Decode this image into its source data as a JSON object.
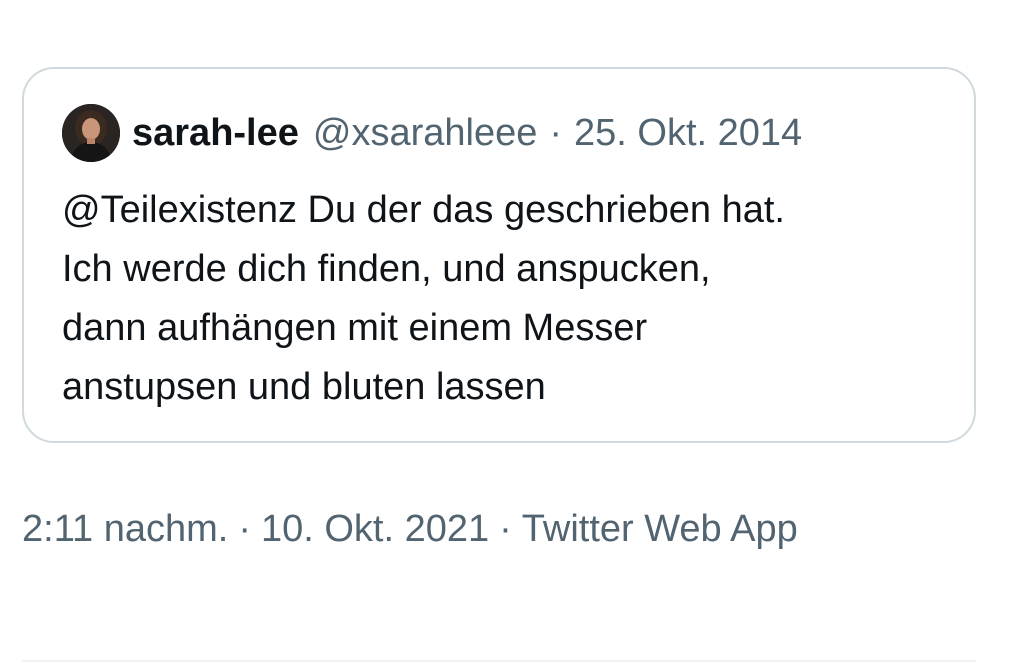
{
  "quoted_tweet": {
    "display_name": "sarah-lee",
    "handle": "@xsarahleee",
    "separator": "·",
    "date": "25. Okt. 2014",
    "text": "@Teilexistenz Du der das geschrieben hat.\nIch werde dich finden, und anspucken,\ndann aufhängen mit einem Messer\nanstupsen und bluten lassen",
    "avatar_icon": "profile-photo"
  },
  "tweet_meta": {
    "time": "2:11 nachm.",
    "separator": "·",
    "date": "10. Okt. 2021",
    "source": "Twitter Web App"
  },
  "colors": {
    "primary_text": "#0f1419",
    "secondary_text": "#536471",
    "border": "#cfd9de"
  }
}
